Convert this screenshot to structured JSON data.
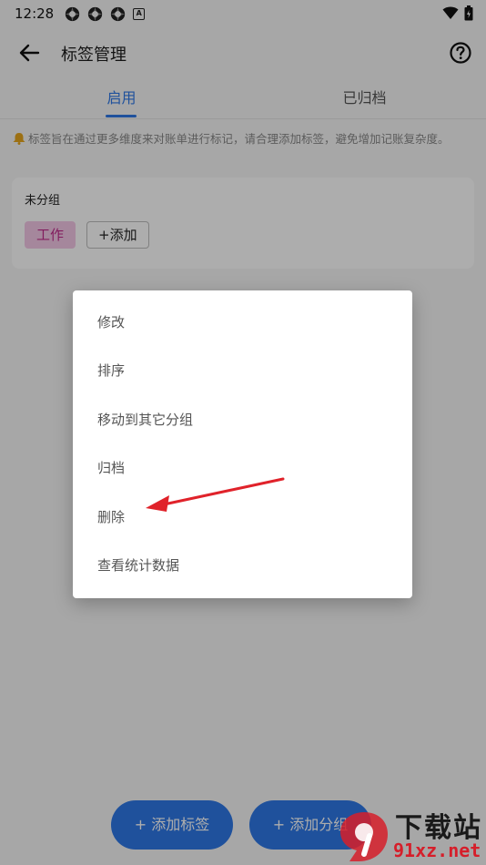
{
  "status_bar": {
    "time": "12:28",
    "icons": [
      "app-icon",
      "app-icon",
      "app-icon",
      "a-icon",
      "wifi-icon",
      "battery-icon"
    ]
  },
  "app_bar": {
    "title": "标签管理",
    "back_icon": "arrow-left-icon",
    "help_icon": "help-circle-icon"
  },
  "tabs": [
    {
      "label": "启用",
      "active": true
    },
    {
      "label": "已归档",
      "active": false
    }
  ],
  "notice": {
    "icon": "bell-icon",
    "text": "标签旨在通过更多维度来对账单进行标记，请合理添加标签，避免增加记账复杂度。"
  },
  "group": {
    "title": "未分组",
    "tags": [
      "工作"
    ],
    "add_label": "+添加"
  },
  "context_menu": {
    "items": [
      "修改",
      "排序",
      "移动到其它分组",
      "归档",
      "删除",
      "查看统计数据"
    ]
  },
  "fabs": {
    "add_tag": "+ 添加标签",
    "add_group": "+ 添加分组"
  },
  "watermark": {
    "title": "下载站",
    "url": "91xz.net"
  },
  "colors": {
    "accent": "#2f78e6",
    "tag_bg": "#f4c8e6",
    "tag_text": "#c02a8b",
    "annotation_arrow": "#e0222a"
  }
}
